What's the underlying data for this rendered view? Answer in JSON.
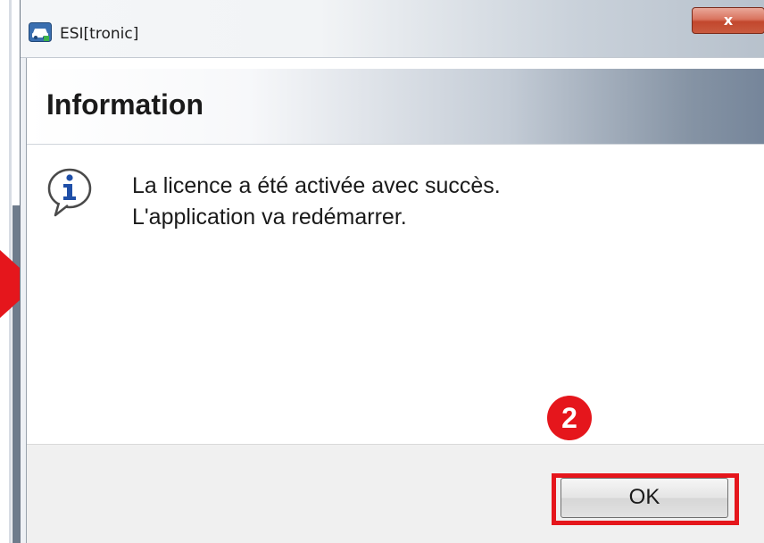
{
  "window": {
    "title": "ESI[tronic]",
    "close_label": "x"
  },
  "header": {
    "title": "Information"
  },
  "message": {
    "line1": "La licence a été activée avec succès.",
    "line2": "L'application va redémarrer."
  },
  "footer": {
    "ok_label": "OK"
  },
  "annotations": {
    "step_number": "2",
    "highlight_color": "#e5161c"
  },
  "icons": {
    "app": "esitronic-car-icon",
    "info": "info-speech-bubble-icon"
  },
  "colors": {
    "annotation_red": "#e5161c",
    "close_button_red": "#c2472d"
  }
}
